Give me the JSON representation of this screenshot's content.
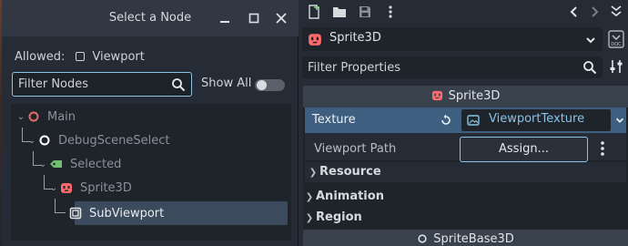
{
  "dialog": {
    "title": "Select a Node",
    "allowed_label": "Allowed:",
    "allowed_type": "Viewport",
    "filter_placeholder": "Filter Nodes",
    "show_all_label": "Show All",
    "show_all_on": false,
    "tree": [
      {
        "label": "Main",
        "icon": "node-circle-icon",
        "color": "#e06c6c"
      },
      {
        "label": "DebugSceneSelect",
        "icon": "control-circle-icon",
        "color": "#ffffff"
      },
      {
        "label": "Selected",
        "icon": "tag-icon",
        "color": "#6ec06e"
      },
      {
        "label": "Sprite3D",
        "icon": "sprite3d-icon",
        "color": "#ff6b6b"
      },
      {
        "label": "SubViewport",
        "icon": "viewport-icon",
        "color": "#e8e8e8"
      }
    ]
  },
  "inspector": {
    "node_name": "Sprite3D",
    "filter_placeholder": "Filter Properties",
    "section_title": "Sprite3D",
    "texture_label": "Texture",
    "texture_value": "ViewportTexture",
    "viewport_path_label": "Viewport Path",
    "assign_label": "Assign...",
    "resource_label": "Resource",
    "animation_label": "Animation",
    "region_label": "Region",
    "base_section_title": "SpriteBase3D",
    "accent_color": "#8ac3e6"
  }
}
